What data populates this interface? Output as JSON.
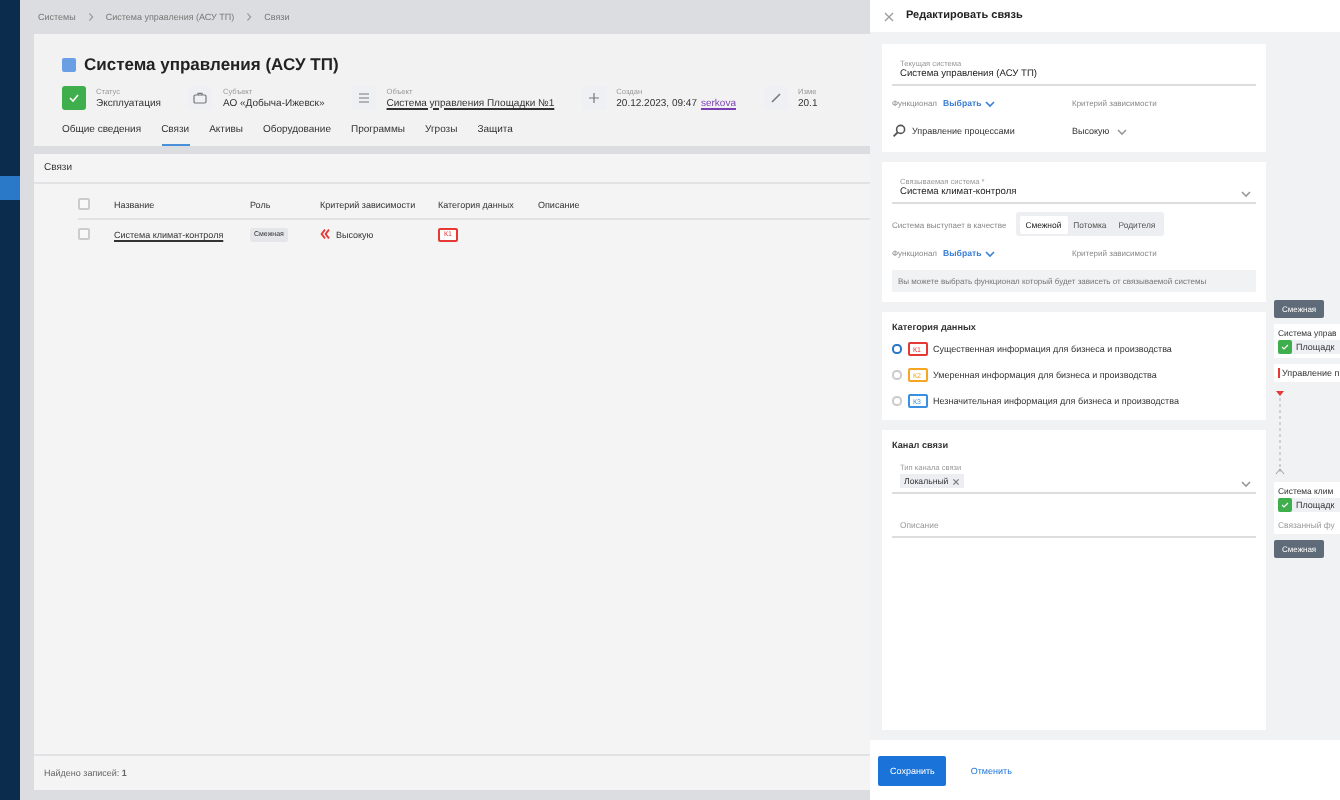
{
  "breadcrumbs": [
    "Системы",
    "Система управления (АСУ ТП)",
    "Связи"
  ],
  "header": {
    "title": "Система управления (АСУ ТП)",
    "fields": [
      {
        "kind": "status",
        "label": "Статус",
        "value": "Эксплуатация"
      },
      {
        "kind": "briefcase",
        "label": "Субъект",
        "value": "АО «Добыча-Ижевск»"
      },
      {
        "kind": "grid",
        "label": "Объект",
        "value": "Система управления Площадки №1",
        "link": true
      },
      {
        "kind": "plus",
        "label": "Создан",
        "value": "20.12.2023, 09:47",
        "author": "serkova"
      },
      {
        "kind": "edit",
        "label": "Изме",
        "value": "20.1"
      }
    ]
  },
  "tabs": [
    {
      "label": "Общие сведения",
      "selected": false
    },
    {
      "label": "Связи",
      "selected": true
    },
    {
      "label": "Активы",
      "selected": false
    },
    {
      "label": "Оборудование",
      "selected": false
    },
    {
      "label": "Программы",
      "selected": false
    },
    {
      "label": "Угрозы",
      "selected": false
    },
    {
      "label": "Защита",
      "selected": false
    }
  ],
  "links": {
    "title": "Связи",
    "all_checked": false,
    "columns": [
      "Название",
      "Роль",
      "Критерий зависимости",
      "Категория данных",
      "Описание"
    ],
    "rows": [
      {
        "checked": false,
        "name": "Система климат-контроля",
        "role": "Смежная",
        "criterion": "Высокую",
        "category": "К1",
        "color": "#e53935"
      }
    ],
    "found_label": "Найдено записей:",
    "found_count": "1"
  },
  "drawer": {
    "title": "Редактировать связь",
    "current": {
      "label": "Текущая система",
      "value": "Система управления (АСУ ТП)",
      "functional_label": "Функционал",
      "functional_action": "Выбрать",
      "criterion_label": "Критерий зависимости",
      "function_item": "Управление процессами",
      "criterion_value": "Высокую"
    },
    "linked": {
      "label": "Связываемая система *",
      "value": "Система климат-контроля",
      "role_label": "Система выступает в качестве",
      "roles": [
        {
          "label": "Смежной",
          "selected": true
        },
        {
          "label": "Потомка",
          "selected": false
        },
        {
          "label": "Родителя",
          "selected": false
        }
      ],
      "functional_label": "Функционал",
      "functional_action": "Выбрать",
      "criterion_label": "Критерий зависимости",
      "hint": "Вы можете выбрать функционал который будет зависеть от связываемой системы"
    },
    "data_category": {
      "title": "Категория данных",
      "options": [
        {
          "code": "К1",
          "text": "Существенная информация для бизнеса и производства",
          "selected": true,
          "color": "#e53935"
        },
        {
          "code": "К2",
          "text": "Умеренная информация для бизнеса и производства",
          "selected": false,
          "color": "#f5a623"
        },
        {
          "code": "К3",
          "text": "Незначительная информация для бизнеса и производства",
          "selected": false,
          "color": "#3b8fe0"
        }
      ]
    },
    "channel": {
      "title": "Канал связи",
      "type_label": "Тип канала связи",
      "tags": [
        "Локальный"
      ],
      "description_placeholder": "Описание"
    },
    "buttons": {
      "save": "Сохранить",
      "cancel": "Отменить"
    },
    "diagram": {
      "top_chip": "Смежная",
      "source_name": "Система управ",
      "source_object": "Площадк",
      "source_function": "Управление п",
      "target_name": "Система клим",
      "target_object": "Площадк",
      "target_function": "Связанный фу",
      "bottom_chip": "Смежная"
    }
  }
}
